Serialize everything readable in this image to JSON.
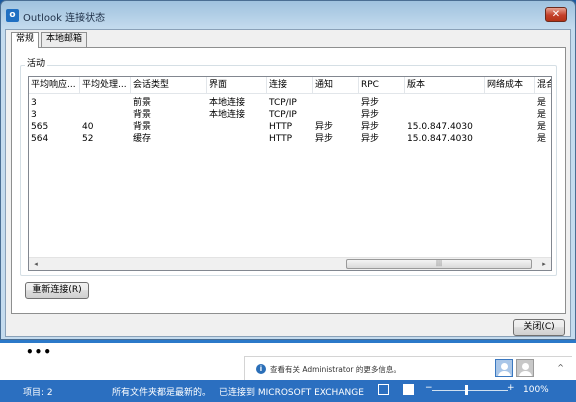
{
  "window": {
    "title": "Outlook 连接状态",
    "close_glyph": "✕"
  },
  "tabs": [
    {
      "label": "常规"
    },
    {
      "label": "本地邮箱"
    }
  ],
  "group": {
    "label": "活动"
  },
  "table": {
    "columns": [
      "平均响应...",
      "平均处理...",
      "会话类型",
      "界面",
      "连接",
      "通知",
      "RPC",
      "版本",
      "网络成本",
      "混合"
    ],
    "rows": [
      [
        "3",
        "",
        "前景",
        "本地连接",
        "TCP/IP",
        "",
        "异步",
        "",
        "",
        "是"
      ],
      [
        "3",
        "",
        "背景",
        "本地连接",
        "TCP/IP",
        "",
        "异步",
        "",
        "",
        "是"
      ],
      [
        "565",
        "40",
        "背景",
        "",
        "HTTP",
        "异步",
        "异步",
        "15.0.847.4030",
        "",
        "是"
      ],
      [
        "564",
        "52",
        "缓存",
        "",
        "HTTP",
        "异步",
        "异步",
        "15.0.847.4030",
        "",
        "是"
      ]
    ],
    "scroll_left": "◂",
    "scroll_right": "▸",
    "scroll_grip": "|||"
  },
  "buttons": {
    "reconnect": "重新连接(R)",
    "close": "关闭(C)"
  },
  "outlook": {
    "more": "•••",
    "people_info": "查看有关 Administrator 的更多信息。",
    "info_glyph": "i",
    "chevron": "^"
  },
  "statusbar": {
    "items": "项目: 2",
    "sync": "所有文件夹都是最新的。",
    "connection": "已连接到 MICROSOFT EXCHANGE",
    "zoom_minus": "−",
    "zoom_plus": "+",
    "zoom": "100%",
    "zoom_level": 0.45
  },
  "colors": {
    "accent": "#2b6fc0",
    "titlebar": "#c4dbee",
    "close": "#c4402a"
  }
}
